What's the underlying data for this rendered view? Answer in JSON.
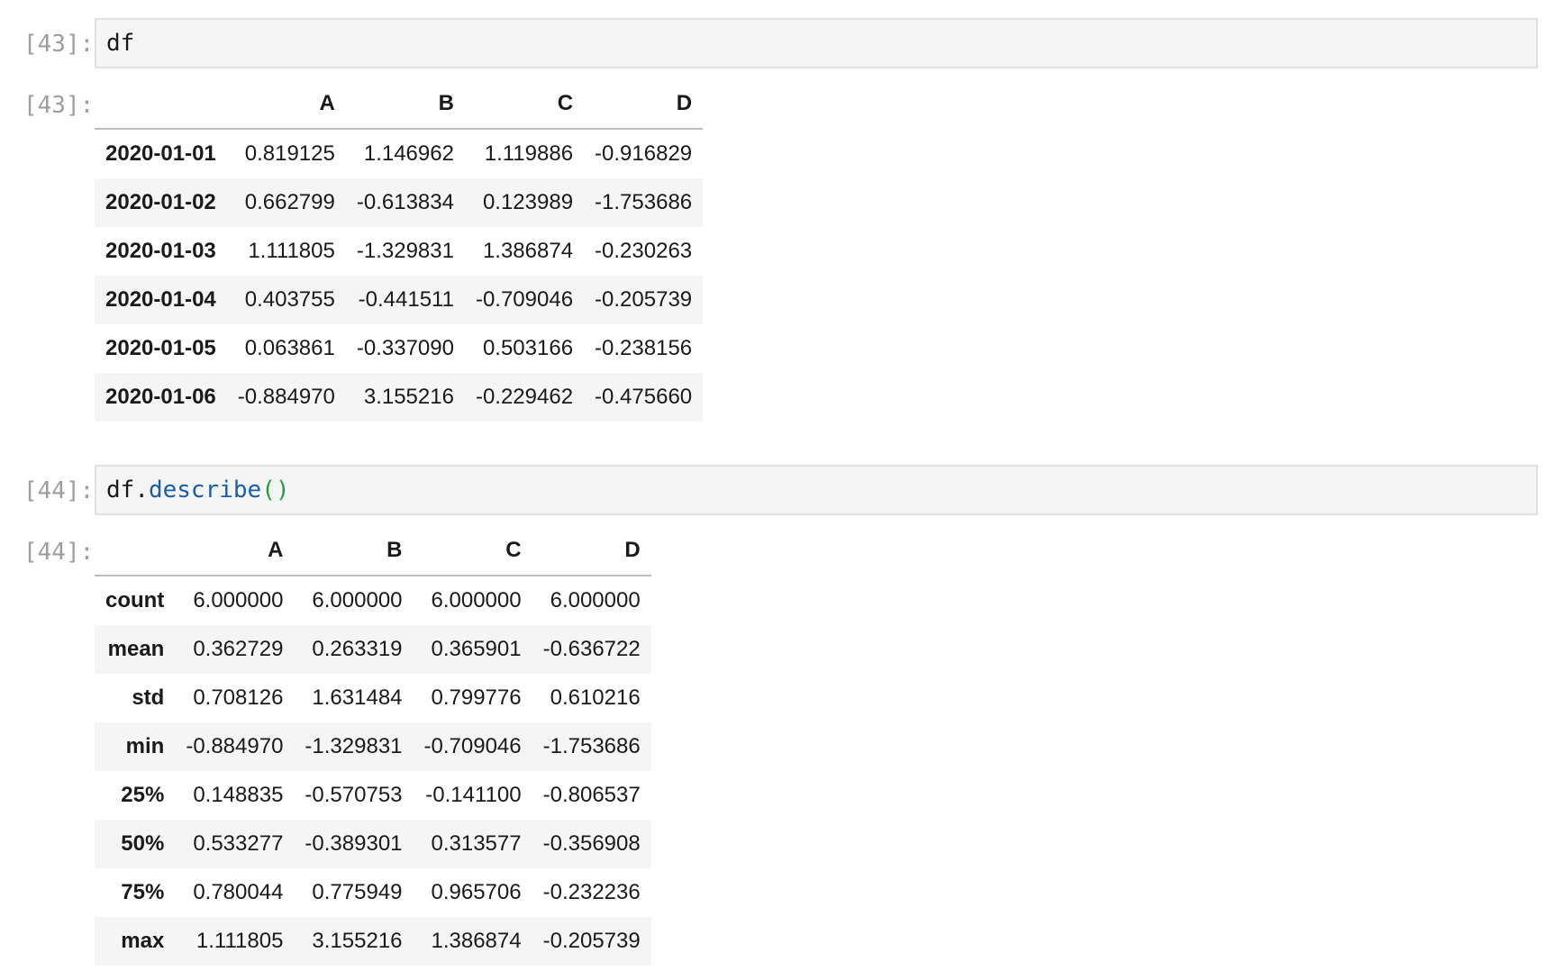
{
  "cells": [
    {
      "prompt_in": "[43]:",
      "code_name": "df",
      "prompt_out": "[43]:",
      "table": {
        "columns": [
          "",
          "A",
          "B",
          "C",
          "D"
        ],
        "rows": [
          {
            "index": "2020-01-01",
            "values": [
              "0.819125",
              "1.146962",
              "1.119886",
              "-0.916829"
            ]
          },
          {
            "index": "2020-01-02",
            "values": [
              "0.662799",
              "-0.613834",
              "0.123989",
              "-1.753686"
            ]
          },
          {
            "index": "2020-01-03",
            "values": [
              "1.111805",
              "-1.329831",
              "1.386874",
              "-0.230263"
            ]
          },
          {
            "index": "2020-01-04",
            "values": [
              "0.403755",
              "-0.441511",
              "-0.709046",
              "-0.205739"
            ]
          },
          {
            "index": "2020-01-05",
            "values": [
              "0.063861",
              "-0.337090",
              "0.503166",
              "-0.238156"
            ]
          },
          {
            "index": "2020-01-06",
            "values": [
              "-0.884970",
              "3.155216",
              "-0.229462",
              "-0.475660"
            ]
          }
        ]
      }
    },
    {
      "prompt_in": "[44]:",
      "code_name": "df",
      "code_dot": ".",
      "code_func": "describe",
      "code_parens": "()",
      "prompt_out": "[44]:",
      "table": {
        "columns": [
          "",
          "A",
          "B",
          "C",
          "D"
        ],
        "rows": [
          {
            "index": "count",
            "values": [
              "6.000000",
              "6.000000",
              "6.000000",
              "6.000000"
            ]
          },
          {
            "index": "mean",
            "values": [
              "0.362729",
              "0.263319",
              "0.365901",
              "-0.636722"
            ]
          },
          {
            "index": "std",
            "values": [
              "0.708126",
              "1.631484",
              "0.799776",
              "0.610216"
            ]
          },
          {
            "index": "min",
            "values": [
              "-0.884970",
              "-1.329831",
              "-0.709046",
              "-1.753686"
            ]
          },
          {
            "index": "25%",
            "values": [
              "0.148835",
              "-0.570753",
              "-0.141100",
              "-0.806537"
            ]
          },
          {
            "index": "50%",
            "values": [
              "0.533277",
              "-0.389301",
              "0.313577",
              "-0.356908"
            ]
          },
          {
            "index": "75%",
            "values": [
              "0.780044",
              "0.775949",
              "0.965706",
              "-0.232236"
            ]
          },
          {
            "index": "max",
            "values": [
              "1.111805",
              "3.155216",
              "1.386874",
              "-0.205739"
            ]
          }
        ]
      }
    }
  ]
}
